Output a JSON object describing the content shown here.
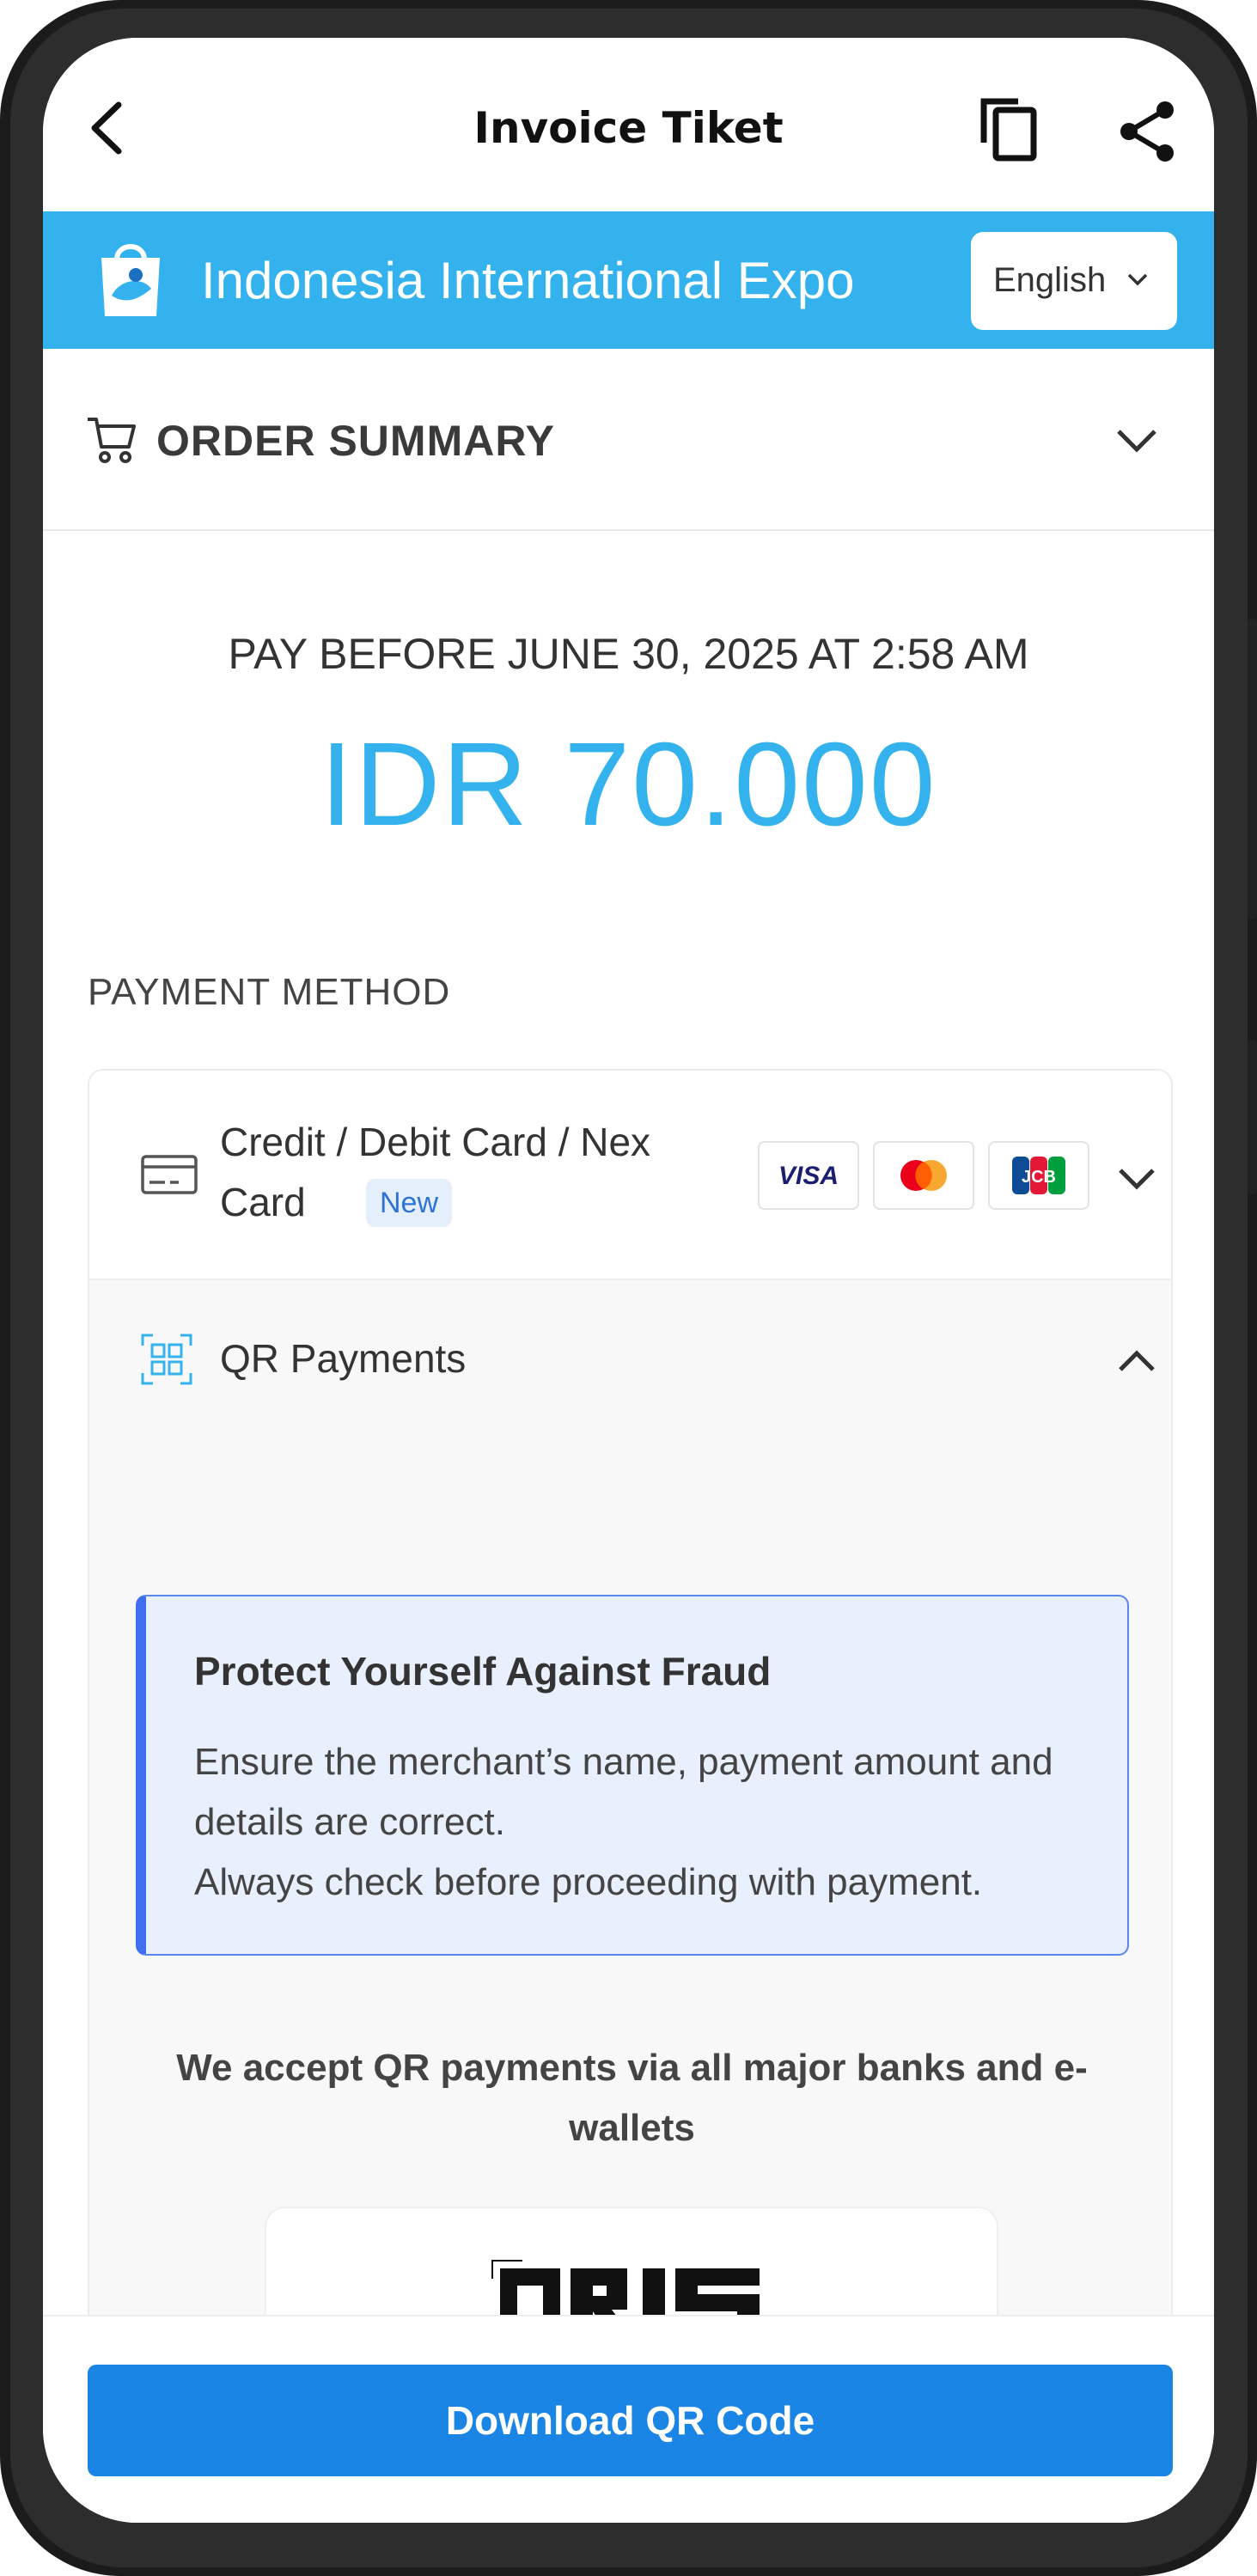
{
  "appbar": {
    "title": "Invoice Tiket",
    "back_icon": "back-arrow-icon",
    "copy_icon": "copy-icon",
    "share_icon": "share-icon"
  },
  "header": {
    "event_name": "Indonesia International Expo",
    "language": "English",
    "brand_color": "#33b2ee"
  },
  "order_summary": {
    "label": "ORDER SUMMARY"
  },
  "payment": {
    "deadline": "PAY BEFORE JUNE 30, 2025 AT 2:58 AM",
    "amount": "IDR 70.000",
    "method_label": "PAYMENT METHOD",
    "methods": [
      {
        "label_line1": "Credit / Debit Card / Nex",
        "label_line2": "Card",
        "badge": "New",
        "brands": [
          "VISA",
          "Mastercard",
          "JCB"
        ],
        "expanded": false
      },
      {
        "label": "QR Payments",
        "expanded": true
      }
    ]
  },
  "fraud_notice": {
    "title": "Protect Yourself Against Fraud",
    "line1": "Ensure the merchant’s name, payment amount and details are correct.",
    "line2": "Always check before proceeding with payment."
  },
  "qr_info": {
    "accept_text": "We accept QR payments via all major banks and e-wallets",
    "logo_text": "QRIS"
  },
  "actions": {
    "download_label": "Download QR Code",
    "button_color": "#1a85e5"
  }
}
